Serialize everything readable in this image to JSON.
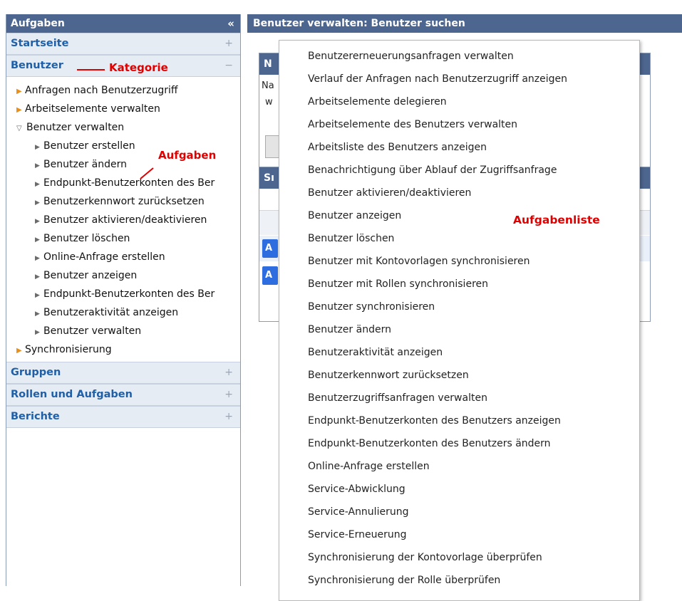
{
  "sidebar": {
    "title": "Aufgaben",
    "collapse_icon": "«",
    "categories": {
      "start": {
        "label": "Startseite",
        "toggle": "+"
      },
      "users": {
        "label": "Benutzer",
        "toggle": "−"
      },
      "groups": {
        "label": "Gruppen",
        "toggle": "+"
      },
      "roles": {
        "label": "Rollen und Aufgaben",
        "toggle": "+"
      },
      "reports": {
        "label": "Berichte",
        "toggle": "+"
      }
    },
    "tree": {
      "access_requests": "Anfragen nach Benutzerzugriff",
      "work_items": "Arbeitselemente verwalten",
      "manage_users": "Benutzer verwalten",
      "sub": [
        "Benutzer erstellen",
        "Benutzer ändern",
        "Endpunkt-Benutzerkonten des Ber",
        "Benutzerkennwort zurücksetzen",
        "Benutzer aktivieren/deaktivieren",
        "Benutzer löschen",
        "Online-Anfrage erstellen",
        "Benutzer anzeigen",
        "Endpunkt-Benutzerkonten des Ber",
        "Benutzeraktivität anzeigen",
        "Benutzer verwalten"
      ],
      "sync": "Synchronisierung"
    }
  },
  "annotations": {
    "category": "Kategorie",
    "tasks": "Aufgaben",
    "task_list": "Aufgabenliste"
  },
  "main": {
    "title": "Benutzer verwalten: Benutzer suchen",
    "box1_head": "N",
    "box1_line1": "Na",
    "box1_line2": "w",
    "box2_head": "Sı",
    "btn1": "A",
    "btn2": "A"
  },
  "menu": {
    "items": [
      "Benutzererneuerungsanfragen verwalten",
      "Verlauf der Anfragen nach Benutzerzugriff anzeigen",
      "Arbeitselemente delegieren",
      "Arbeitselemente des Benutzers verwalten",
      "Arbeitsliste des Benutzers anzeigen",
      "Benachrichtigung über Ablauf der Zugriffsanfrage",
      "Benutzer aktivieren/deaktivieren",
      "Benutzer anzeigen",
      "Benutzer löschen",
      "Benutzer mit Kontovorlagen synchronisieren",
      "Benutzer mit Rollen synchronisieren",
      "Benutzer synchronisieren",
      "Benutzer ändern",
      "Benutzeraktivität anzeigen",
      "Benutzerkennwort zurücksetzen",
      "Benutzerzugriffsanfragen verwalten",
      "Endpunkt-Benutzerkonten des Benutzers anzeigen",
      "Endpunkt-Benutzerkonten des Benutzers ändern",
      "Online-Anfrage erstellen",
      "Service-Abwicklung",
      "Service-Annulierung",
      "Service-Erneuerung",
      "Synchronisierung der Kontovorlage überprüfen",
      "Synchronisierung der Rolle überprüfen"
    ]
  },
  "colors": {
    "header_bg": "#4d668f",
    "category_text": "#1f5fa8",
    "category_bg": "#e6ecf4",
    "annotation_red": "#e00000",
    "tree_arrow_orange": "#e8901a"
  }
}
